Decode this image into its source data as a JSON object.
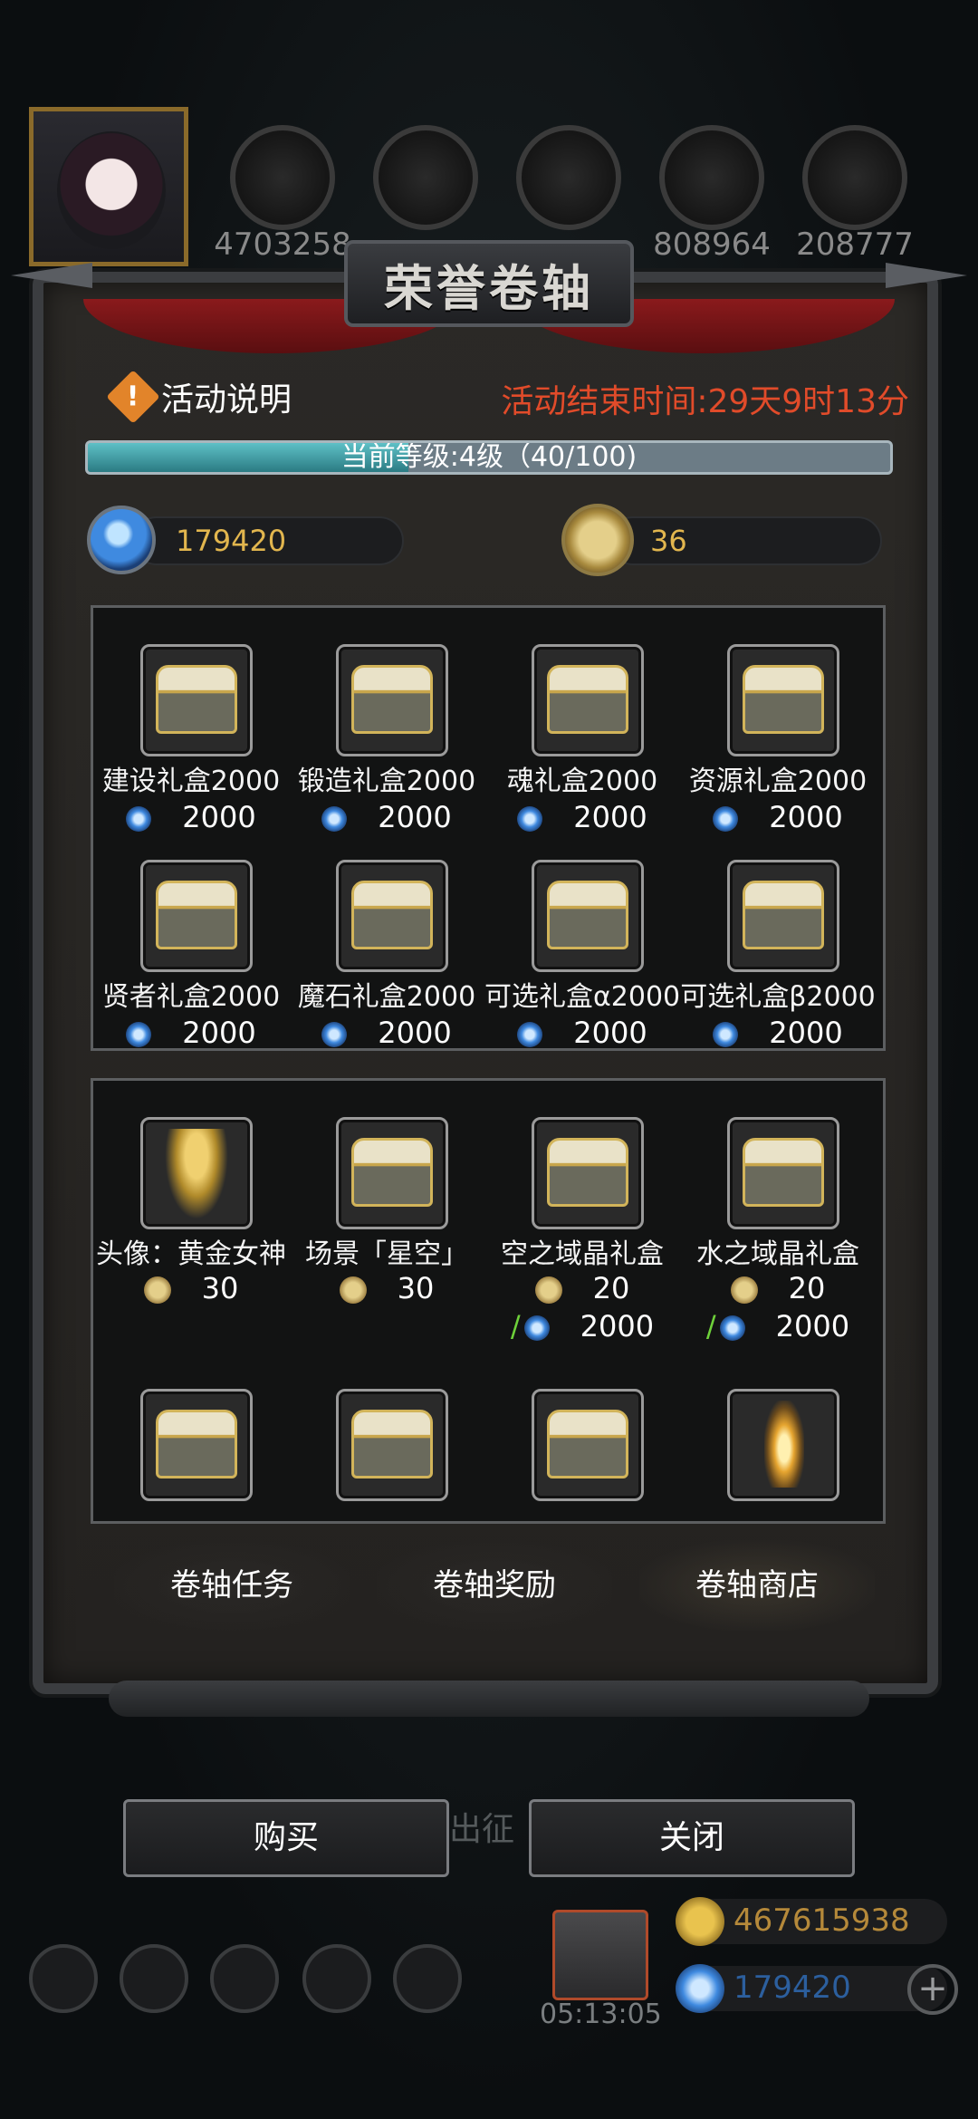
{
  "top_bar": {
    "resources": [
      {
        "icon": "meat-icon",
        "value": "4703258"
      },
      {
        "icon": "wood-icon",
        "value": ""
      },
      {
        "icon": "iron-icon",
        "value": ""
      },
      {
        "icon": "crystal-icon",
        "value": "808964"
      },
      {
        "icon": "ore-icon",
        "value": "208777"
      }
    ]
  },
  "dialog": {
    "title": "荣誉卷轴",
    "info_label": "活动说明",
    "countdown": "活动结束时间:29天9时13分",
    "level_text": "当前等级:4级（40/100)",
    "level_progress": 0.4,
    "gem_balance": "179420",
    "coin_balance": "36",
    "gift_boxes": [
      {
        "name": "建设礼盒2000",
        "price": "2000"
      },
      {
        "name": "锻造礼盒2000",
        "price": "2000"
      },
      {
        "name": "魂礼盒2000",
        "price": "2000"
      },
      {
        "name": "资源礼盒2000",
        "price": "2000"
      },
      {
        "name": "贤者礼盒2000",
        "price": "2000"
      },
      {
        "name": "魔石礼盒2000",
        "price": "2000"
      },
      {
        "name": "可选礼盒α2000",
        "price": "2000"
      },
      {
        "name": "可选礼盒β2000",
        "price": "2000"
      }
    ],
    "special_items": [
      {
        "name": "头像：黄金女神",
        "coin_price": "30",
        "gem_price": "",
        "icon": "golden-goddess-icon"
      },
      {
        "name": "场景「星空」",
        "coin_price": "30",
        "gem_price": "",
        "icon": "chest-icon"
      },
      {
        "name": "空之域晶礼盒",
        "coin_price": "20",
        "gem_price": "2000",
        "icon": "chest-icon"
      },
      {
        "name": "水之域晶礼盒",
        "coin_price": "20",
        "gem_price": "2000",
        "icon": "chest-icon"
      },
      {
        "name": "",
        "coin_price": "",
        "gem_price": "",
        "icon": "chest-icon"
      },
      {
        "name": "",
        "coin_price": "",
        "gem_price": "",
        "icon": "chest-icon"
      },
      {
        "name": "",
        "coin_price": "",
        "gem_price": "",
        "icon": "chest-icon"
      },
      {
        "name": "",
        "coin_price": "",
        "gem_price": "",
        "icon": "lantern-icon"
      }
    ],
    "tabs": [
      "卷轴任务",
      "卷轴奖励",
      "卷轴商店"
    ],
    "buy_label": "购买",
    "close_label": "关闭"
  },
  "background": {
    "march_text": "出征",
    "timer": "05:13:05",
    "gold": "467615938",
    "gems": "179420"
  },
  "colors": {
    "countdown": "#e14b2a",
    "wallet_value": "#e2b64e",
    "progress_fill": "#3fa0a8"
  }
}
